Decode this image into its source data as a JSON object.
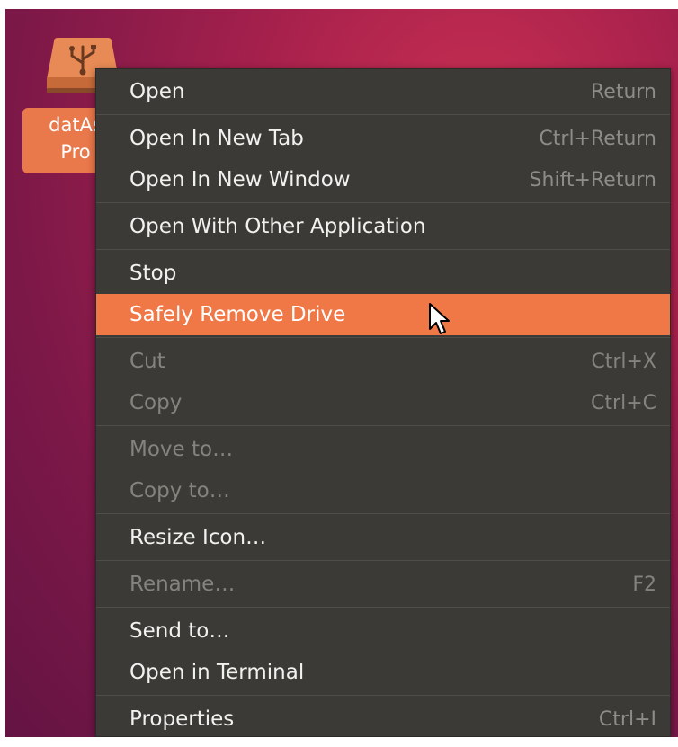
{
  "desktop": {
    "icon": "usb-drive-icon",
    "label_line1": "datAs",
    "label_line2": "Pro"
  },
  "menu": {
    "items": [
      {
        "label": "Open",
        "shortcut": "Return"
      },
      {
        "label": "Open In New Tab",
        "shortcut": "Ctrl+Return"
      },
      {
        "label": "Open In New Window",
        "shortcut": "Shift+Return"
      },
      {
        "label": "Open With Other Application",
        "shortcut": ""
      },
      {
        "label": "Stop",
        "shortcut": ""
      },
      {
        "label": "Safely Remove Drive",
        "shortcut": ""
      },
      {
        "label": "Cut",
        "shortcut": "Ctrl+X"
      },
      {
        "label": "Copy",
        "shortcut": "Ctrl+C"
      },
      {
        "label": "Move to…",
        "shortcut": ""
      },
      {
        "label": "Copy to…",
        "shortcut": ""
      },
      {
        "label": "Resize Icon…",
        "shortcut": ""
      },
      {
        "label": "Rename…",
        "shortcut": "F2"
      },
      {
        "label": "Send to…",
        "shortcut": ""
      },
      {
        "label": "Open in Terminal",
        "shortcut": ""
      },
      {
        "label": "Properties",
        "shortcut": "Ctrl+I"
      }
    ]
  },
  "colors": {
    "highlight": "#f07746",
    "menu_background": "#3b3a36",
    "desktop_background": "#a5204c"
  },
  "cursor_icon": "mouse-pointer-icon"
}
